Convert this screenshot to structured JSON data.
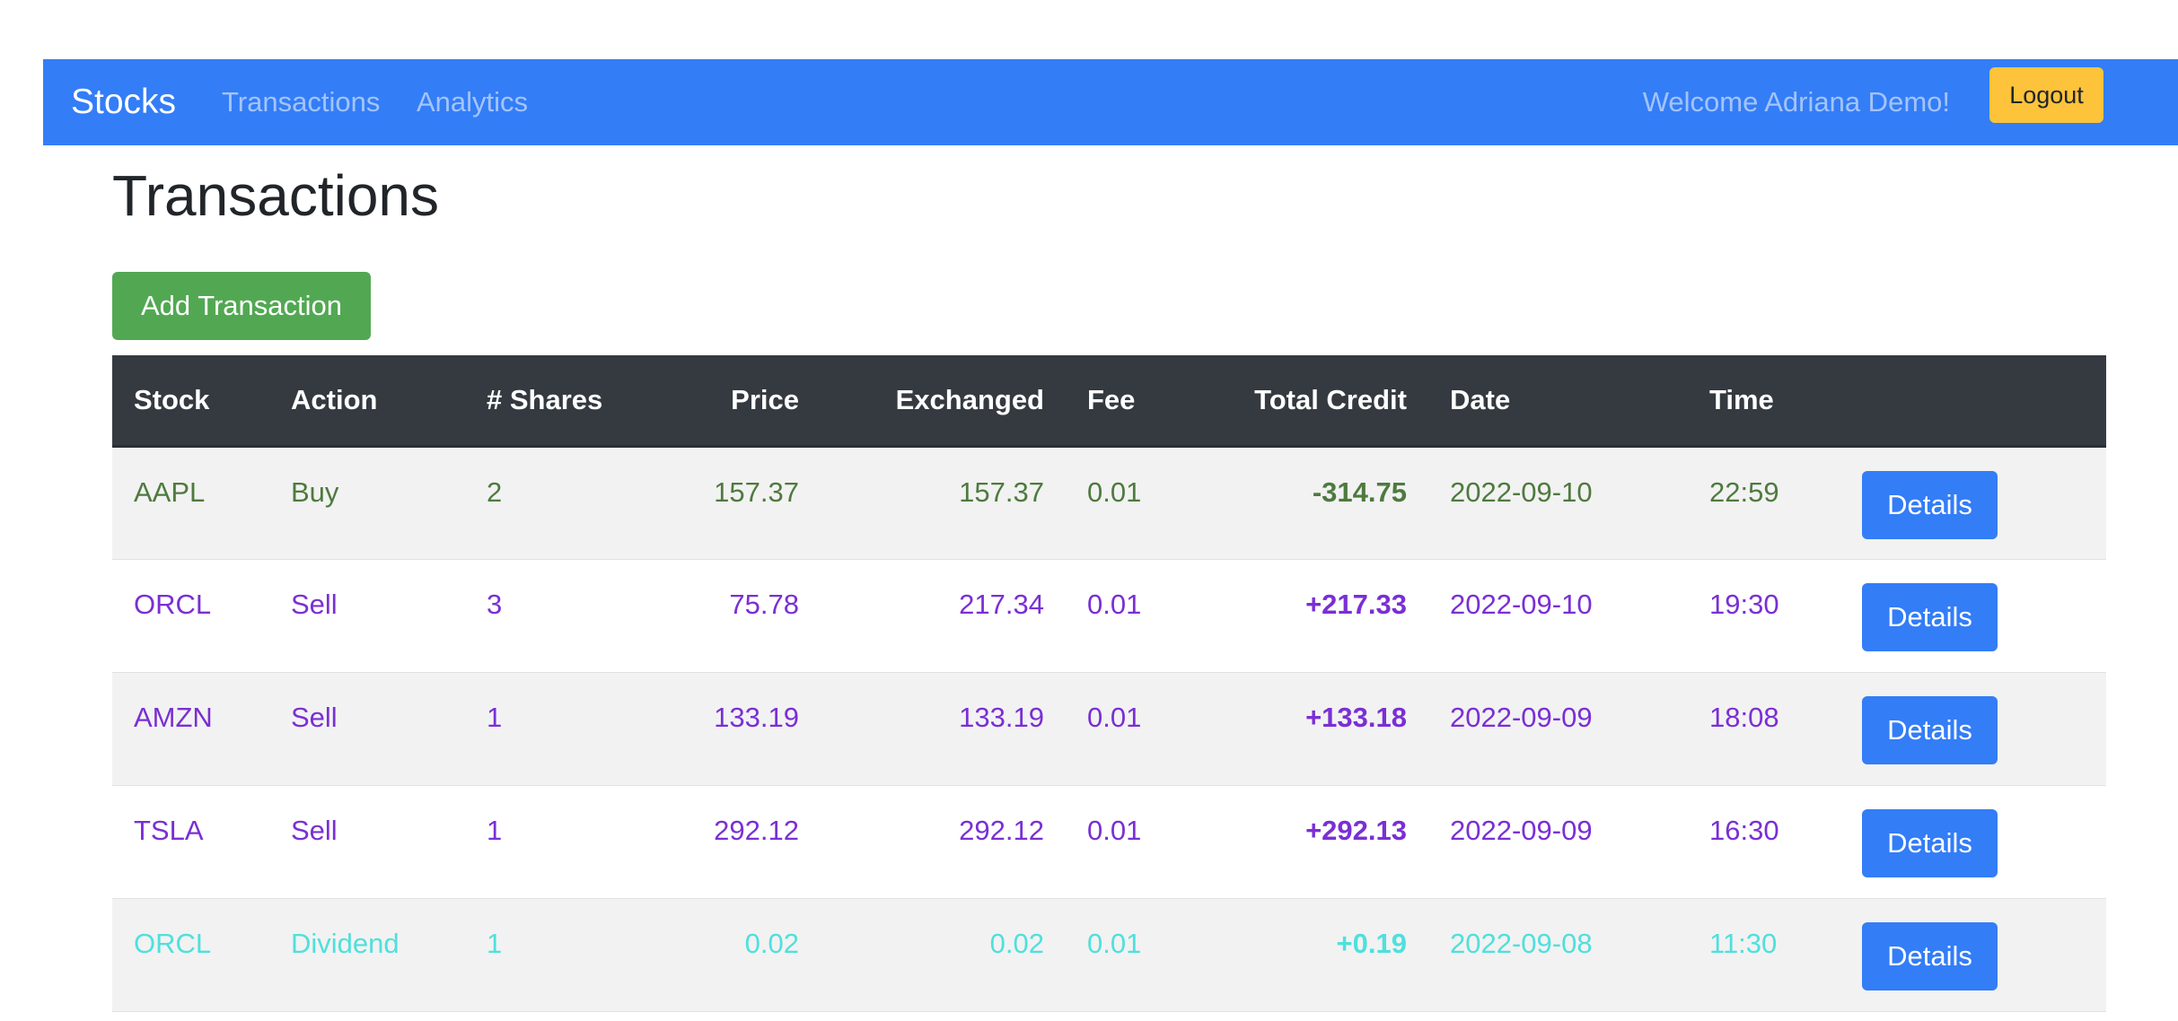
{
  "navbar": {
    "brand": "Stocks",
    "links": [
      "Transactions",
      "Analytics"
    ],
    "welcome": "Welcome Adriana Demo!",
    "logout_label": "Logout"
  },
  "page": {
    "title": "Transactions",
    "add_button_label": "Add Transaction"
  },
  "colors": {
    "navbar": "#337df7",
    "buy": "#4e7a3e",
    "sell": "#7a2fd4",
    "dividend": "#4fe0dc",
    "logout": "#fcc33b",
    "add_button": "#52a852",
    "table_header": "#343a40"
  },
  "table": {
    "columns": [
      "Stock",
      "Action",
      "# Shares",
      "Price",
      "Exchanged",
      "Fee",
      "Total Credit",
      "Date",
      "Time",
      ""
    ],
    "rows": [
      {
        "stock": "AAPL",
        "action": "Buy",
        "shares": "2",
        "price": "157.37",
        "exchanged": "157.37",
        "fee": "0.01",
        "total_credit": "-314.75",
        "date": "2022-09-10",
        "time": "22:59",
        "details_label": "Details",
        "color": "#4e7a3e"
      },
      {
        "stock": "ORCL",
        "action": "Sell",
        "shares": "3",
        "price": "75.78",
        "exchanged": "217.34",
        "fee": "0.01",
        "total_credit": "+217.33",
        "date": "2022-09-10",
        "time": "19:30",
        "details_label": "Details",
        "color": "#7a2fd4"
      },
      {
        "stock": "AMZN",
        "action": "Sell",
        "shares": "1",
        "price": "133.19",
        "exchanged": "133.19",
        "fee": "0.01",
        "total_credit": "+133.18",
        "date": "2022-09-09",
        "time": "18:08",
        "details_label": "Details",
        "color": "#7a2fd4"
      },
      {
        "stock": "TSLA",
        "action": "Sell",
        "shares": "1",
        "price": "292.12",
        "exchanged": "292.12",
        "fee": "0.01",
        "total_credit": "+292.13",
        "date": "2022-09-09",
        "time": "16:30",
        "details_label": "Details",
        "color": "#7a2fd4"
      },
      {
        "stock": "ORCL",
        "action": "Dividend",
        "shares": "1",
        "price": "0.02",
        "exchanged": "0.02",
        "fee": "0.01",
        "total_credit": "+0.19",
        "date": "2022-09-08",
        "time": "11:30",
        "details_label": "Details",
        "color": "#4fe0dc"
      }
    ]
  }
}
